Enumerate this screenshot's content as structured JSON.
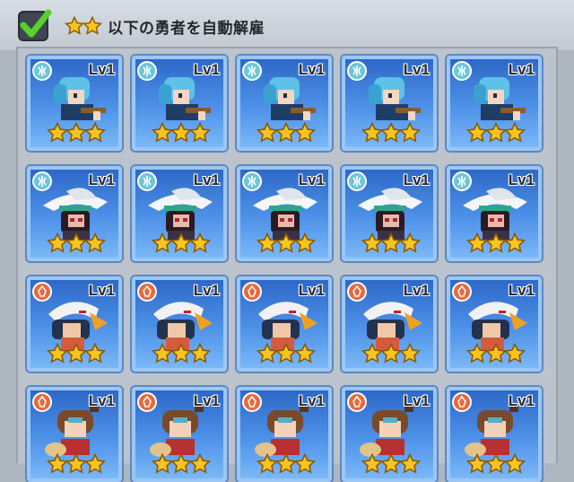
{
  "header": {
    "checked": true,
    "star_count": 2,
    "label": "以下の勇者を自動解雇"
  },
  "colors": {
    "star": "#f7c51e",
    "check": "#57d12c",
    "card_bg": "#3f7fd8",
    "water_element": "#6ec6d8",
    "fire_element": "#e9683c"
  },
  "rows": [
    {
      "hero": "blue-haired-swordsman",
      "element": "water-icon",
      "cards": [
        {
          "level": "Lv1",
          "stars": 3
        },
        {
          "level": "Lv1",
          "stars": 3
        },
        {
          "level": "Lv1",
          "stars": 3
        },
        {
          "level": "Lv1",
          "stars": 3
        },
        {
          "level": "Lv1",
          "stars": 3
        }
      ]
    },
    {
      "hero": "witch-hat-mage",
      "element": "water-icon",
      "cards": [
        {
          "level": "Lv1",
          "stars": 3
        },
        {
          "level": "Lv1",
          "stars": 3
        },
        {
          "level": "Lv1",
          "stars": 3
        },
        {
          "level": "Lv1",
          "stars": 3
        },
        {
          "level": "Lv1",
          "stars": 3
        }
      ]
    },
    {
      "hero": "eagle-helm-warrior",
      "element": "fire-icon",
      "cards": [
        {
          "level": "Lv1",
          "stars": 3
        },
        {
          "level": "Lv1",
          "stars": 3
        },
        {
          "level": "Lv1",
          "stars": 3
        },
        {
          "level": "Lv1",
          "stars": 3
        },
        {
          "level": "Lv1",
          "stars": 3
        }
      ]
    },
    {
      "hero": "brown-haired-fighter",
      "element": "fire-icon",
      "cards": [
        {
          "level": "Lv1",
          "stars": 3
        },
        {
          "level": "Lv1",
          "stars": 3
        },
        {
          "level": "Lv1",
          "stars": 3
        },
        {
          "level": "Lv1",
          "stars": 3
        },
        {
          "level": "Lv1",
          "stars": 3
        }
      ]
    }
  ]
}
